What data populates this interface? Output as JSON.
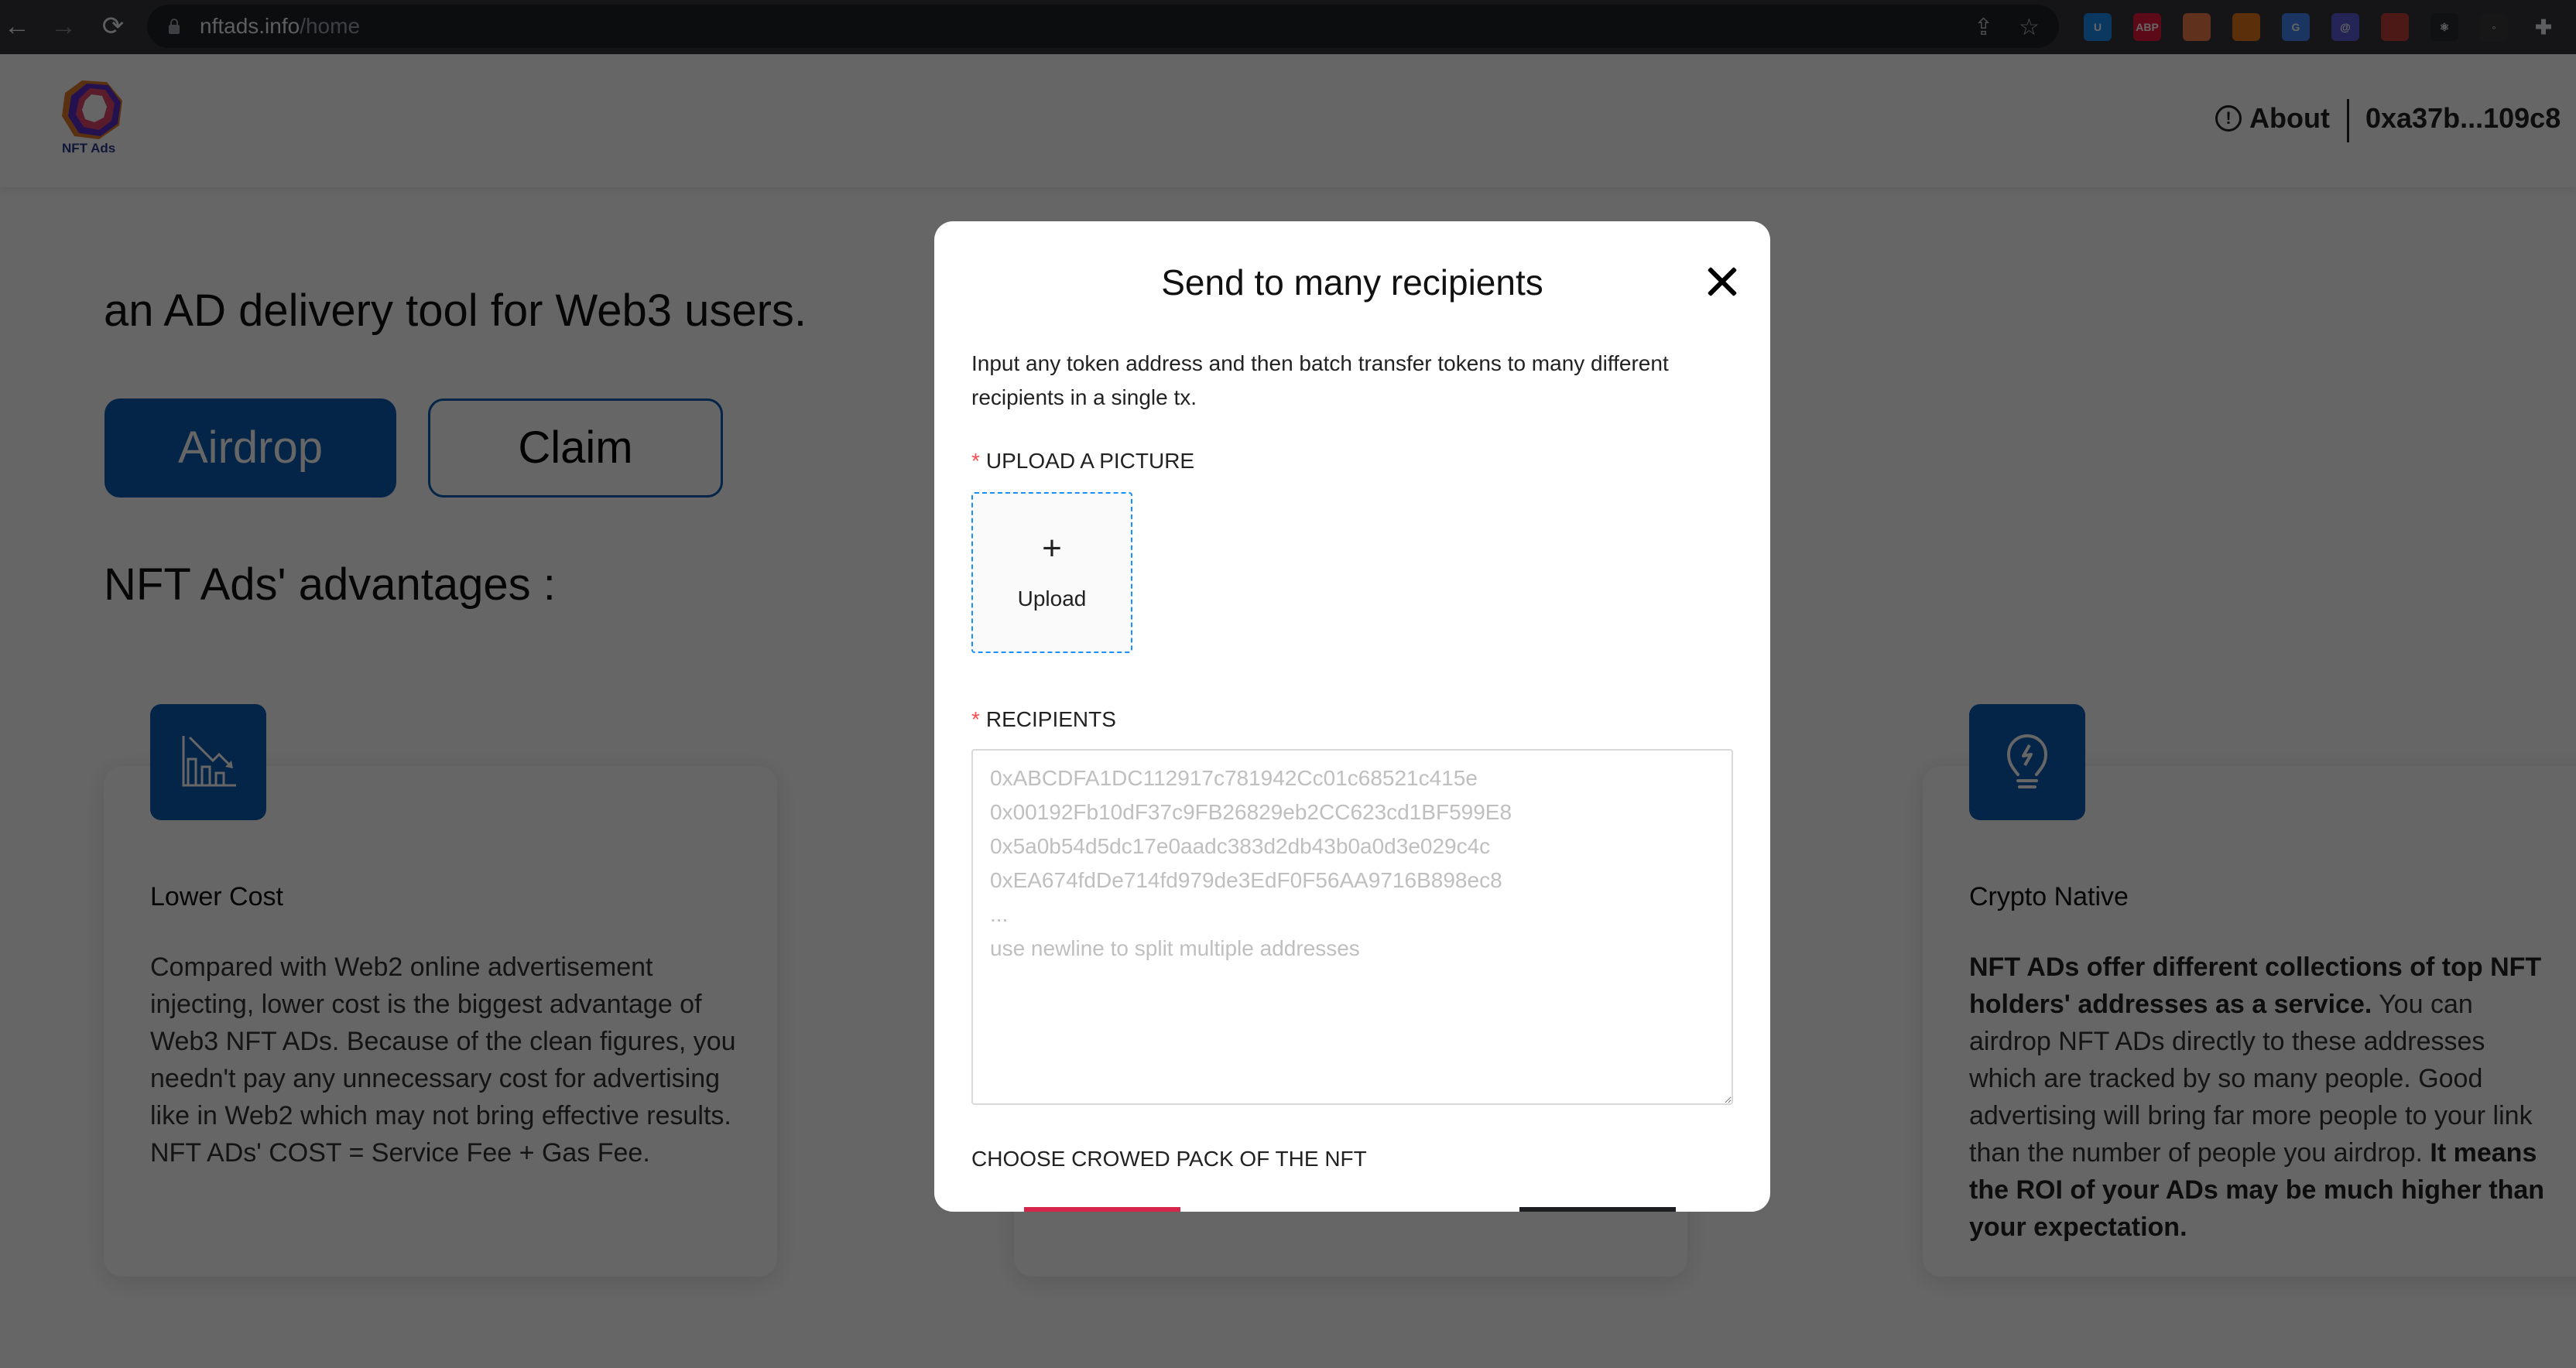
{
  "browser": {
    "url_host": "nftads.info",
    "url_path": "/home",
    "nav": {
      "back": "←",
      "forward": "→",
      "reload": "⟳"
    },
    "omnibox_icons": [
      "share-icon",
      "bookmark-star-icon"
    ],
    "extensions": [
      {
        "name": "ublock-extension-icon",
        "label": "U",
        "color": "#1b8df2"
      },
      {
        "name": "adblock-plus-extension-icon",
        "label": "ABP",
        "color": "#e8193c"
      },
      {
        "name": "octopus-extension-icon",
        "label": "",
        "color": "#f07a4a"
      },
      {
        "name": "metamask-extension-icon",
        "label": "",
        "color": "#e2761b"
      },
      {
        "name": "google-translate-extension-icon",
        "label": "G",
        "color": "#4285f4"
      },
      {
        "name": "at-sign-extension-icon",
        "label": "@",
        "color": "#5b5bd6"
      },
      {
        "name": "pie-chart-extension-icon",
        "label": "",
        "color": "#c1403b"
      },
      {
        "name": "react-devtools-extension-icon",
        "label": "⚛",
        "color": "#2a2b2e"
      },
      {
        "name": "toggle-extension-icon",
        "label": "◦",
        "color": "#3a3b3e"
      },
      {
        "name": "extensions-puzzle-icon",
        "label": "",
        "color": "#35363a"
      }
    ]
  },
  "header": {
    "logo_text": "NFT Ads",
    "about_label": "About",
    "wallet_address": "0xa37b...109c8"
  },
  "hero": {
    "tagline": "an AD delivery tool for Web3 users.",
    "airdrop_label": "Airdrop",
    "claim_label": "Claim",
    "advantages_title": "NFT Ads' advantages :"
  },
  "cards": [
    {
      "icon": "chart-decrease-icon",
      "title": "Lower Cost",
      "body": "Compared with Web2 online advertisement injecting, lower cost is the biggest advantage of Web3 NFT ADs. Because of the clean figures, you needn't pay any unnecessary cost for advertising like in Web2 which may not bring effective results. NFT ADs' COST = Service Fee + Gas Fee."
    },
    {
      "icon": "lightbulb-icon",
      "title": "Crypto Native",
      "body_bold_1": "NFT ADs offer different collections of top NFT holders' addresses as a service.",
      "body_plain": " You can airdrop NFT ADs directly to these addresses which are tracked by so many people. Good advertising will bring far more people to your link than the number of people you airdrop. ",
      "body_bold_2": "It means the ROI of your ADs may be much higher than your expectation."
    }
  ],
  "modal": {
    "title": "Send to many recipients",
    "description": "Input any token address and then batch transfer tokens to many different recipients in a single tx.",
    "upload_label": "UPLOAD A PICTURE",
    "upload_plus": "+",
    "upload_button": "Upload",
    "recipients_label": "RECIPIENTS",
    "recipients_value": "",
    "recipients_placeholder": "0xABCDFA1DC112917c781942Cc01c68521c415e\n0x00192Fb10dF37c9FB26829eb2CC623cd1BF599E8\n0x5a0b54d5dc17e0aadc383d2db43b0a0d3e029c4c\n0xEA674fdDe714fd979de3EdF0F56AA9716B898ec8\n...\nuse newline to split multiple addresses",
    "pack_label": "CHOOSE CROWED PACK OF THE NFT",
    "required_marker": "*"
  },
  "colors": {
    "brand_blue": "#0c5bb5",
    "required_red": "#ff4d4f",
    "upload_border": "#1890ff",
    "pack_red": "#d6264a",
    "pack_dark": "#1d1e22"
  }
}
